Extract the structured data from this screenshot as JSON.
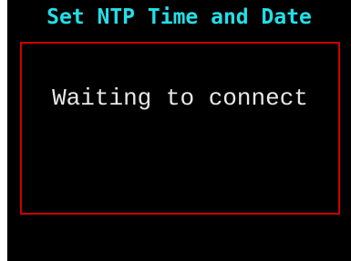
{
  "screen": {
    "title": "Set NTP Time and Date",
    "message": "Waiting to connect"
  },
  "colors": {
    "background": "#000000",
    "title": "#22e0e8",
    "frame_border": "#cc0000",
    "message": "#e8e8e8"
  }
}
